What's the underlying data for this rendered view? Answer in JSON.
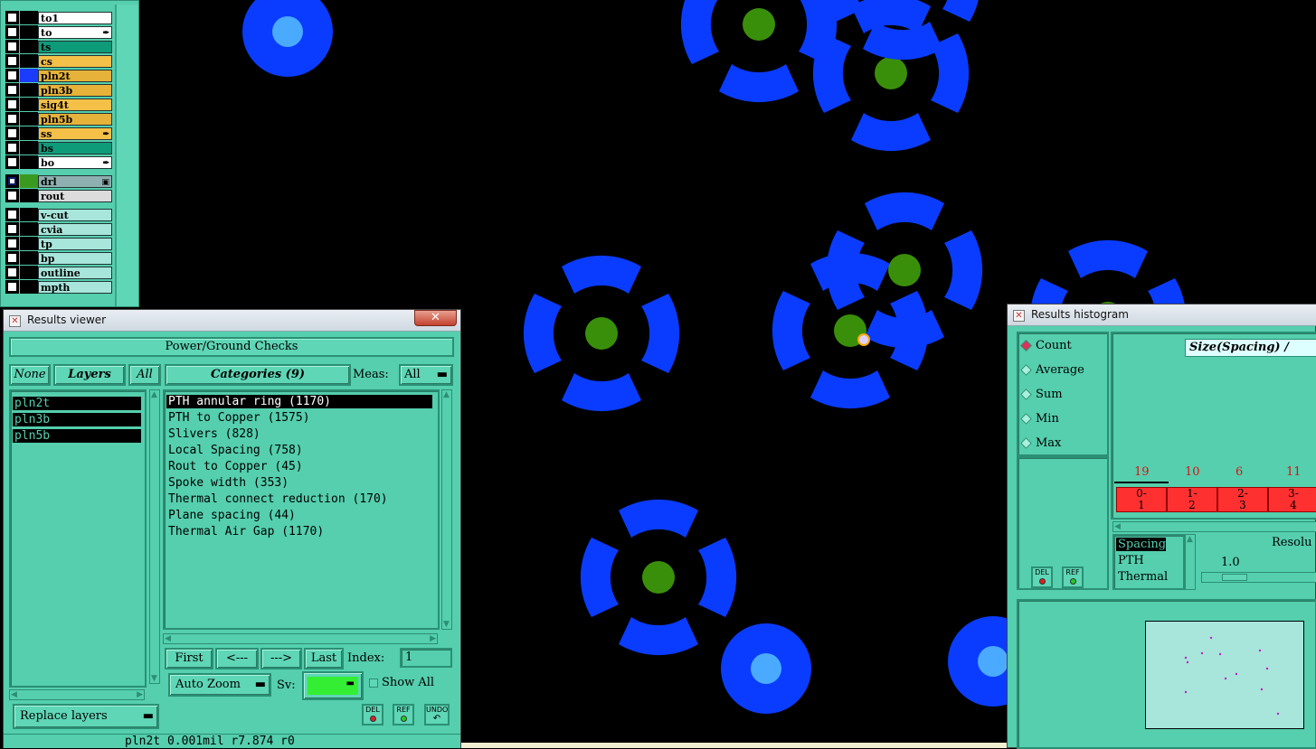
{
  "layers": {
    "group1": [
      {
        "name": "to1",
        "color": "#ffffff",
        "swatch": "#000000",
        "mark": ""
      },
      {
        "name": "to",
        "color": "#ffffff",
        "swatch": "#000000",
        "mark": "✒"
      },
      {
        "name": "ts",
        "color": "#0e9b7a",
        "swatch": "#000000",
        "mark": ""
      },
      {
        "name": "cs",
        "color": "#f4c048",
        "swatch": "#000000",
        "mark": ""
      },
      {
        "name": "pln2t",
        "color": "#e6b23a",
        "swatch": "#1a3cff",
        "mark": ""
      },
      {
        "name": "pln3b",
        "color": "#e6b23a",
        "swatch": "#000000",
        "mark": ""
      },
      {
        "name": "sig4t",
        "color": "#f4c048",
        "swatch": "#000000",
        "mark": ""
      },
      {
        "name": "pln5b",
        "color": "#e6b23a",
        "swatch": "#000000",
        "mark": ""
      },
      {
        "name": "ss",
        "color": "#f4c048",
        "swatch": "#000000",
        "mark": "✒"
      },
      {
        "name": "bs",
        "color": "#0e9b7a",
        "swatch": "#000000",
        "mark": ""
      },
      {
        "name": "bo",
        "color": "#ffffff",
        "swatch": "#000000",
        "mark": "✒"
      }
    ],
    "group2": [
      {
        "name": "drl",
        "color": "#8fb0b0",
        "swatch": "#3a9a20",
        "mark": "▣"
      },
      {
        "name": "rout",
        "color": "#dcdcdc",
        "swatch": "#000000",
        "mark": ""
      }
    ],
    "group3": [
      {
        "name": "v-cut",
        "color": "#a8e6dc",
        "swatch": "#000000",
        "mark": ""
      },
      {
        "name": "cvia",
        "color": "#a8e6dc",
        "swatch": "#000000",
        "mark": ""
      },
      {
        "name": "tp",
        "color": "#a8e6dc",
        "swatch": "#000000",
        "mark": ""
      },
      {
        "name": "bp",
        "color": "#a8e6dc",
        "swatch": "#000000",
        "mark": ""
      },
      {
        "name": "outline",
        "color": "#a8e6dc",
        "swatch": "#000000",
        "mark": ""
      },
      {
        "name": "mpth",
        "color": "#a8e6dc",
        "swatch": "#000000",
        "mark": ""
      }
    ]
  },
  "results_viewer": {
    "title": "Results viewer",
    "close": "✕",
    "header": "Power/Ground Checks",
    "none_label": "None",
    "layers_label": "Layers",
    "all_label": "All",
    "categories_label": "Categories (9)",
    "meas_label": "Meas:",
    "meas_value": "All",
    "layer_list": [
      "pln2t",
      "pln3b",
      "pln5b"
    ],
    "categories": [
      "PTH annular ring (1170)",
      "PTH to Copper (1575)",
      "Slivers (828)",
      "Local Spacing (758)",
      "Rout to Copper (45)",
      "Spoke width (353)",
      "Thermal connect reduction (170)",
      "Plane spacing (44)",
      "Thermal Air Gap (1170)"
    ],
    "first_label": "First",
    "prev_label": "<---",
    "next_label": "--->",
    "last_label": "Last",
    "index_label": "Index:",
    "index_value": "1",
    "zoom_label": "Auto Zoom",
    "sv_label": "Sv:",
    "sv_color": "#33ee33",
    "show_all_label": "Show All",
    "replace_label": "Replace layers",
    "del_label": "DEL",
    "ref_label": "REF",
    "undo_label": "UNDO",
    "status": "pln2t 0.001mil  r7.874  r0"
  },
  "histogram": {
    "title": "Results histogram",
    "measure_options": [
      "Count",
      "Average",
      "Sum",
      "Min",
      "Max"
    ],
    "selected_measure": "Count",
    "header_label": "Size(Spacing) /",
    "bins": [
      {
        "count": "19",
        "label_top": "0-",
        "label_bottom": "1"
      },
      {
        "count": "10",
        "label_top": "1-",
        "label_bottom": "2"
      },
      {
        "count": "6",
        "label_top": "2-",
        "label_bottom": "3"
      },
      {
        "count": "11",
        "label_top": "3-",
        "label_bottom": "4"
      }
    ],
    "category_list": [
      "Spacing",
      "PTH",
      "Thermal"
    ],
    "resolution_label": "Resolu",
    "resolution_value": "1.0",
    "del_label": "DEL",
    "ref_label": "REF"
  }
}
